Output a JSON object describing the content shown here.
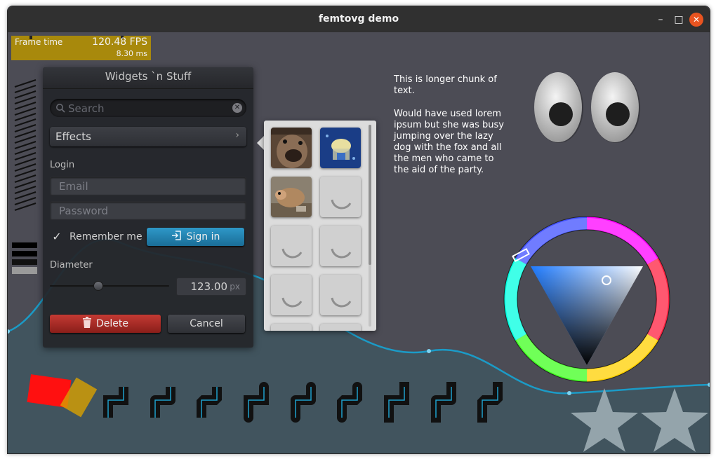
{
  "window": {
    "title": "femtovg demo",
    "minimize_glyph": "–",
    "maximize_glyph": "□",
    "close_glyph": "✕"
  },
  "frame_time": {
    "label": "Frame time",
    "fps": "120.48 FPS",
    "ms": "8.30 ms"
  },
  "panel": {
    "title": "Widgets `n Stuff",
    "search_placeholder": "Search",
    "dropdown_label": "Effects",
    "login_label": "Login",
    "email_placeholder": "Email",
    "password_placeholder": "Password",
    "remember_label": "Remember me",
    "remember_checked": true,
    "signin_label": "Sign in",
    "diameter_label": "Diameter",
    "slider_fraction": 0.4,
    "diameter_value": "123.00",
    "diameter_unit": "px",
    "delete_label": "Delete",
    "cancel_label": "Cancel"
  },
  "thumbnails": {
    "items": [
      {
        "kind": "image",
        "name": "dog"
      },
      {
        "kind": "image",
        "name": "jellyfish"
      },
      {
        "kind": "image",
        "name": "animal"
      },
      {
        "kind": "loading"
      },
      {
        "kind": "loading"
      },
      {
        "kind": "loading"
      },
      {
        "kind": "loading"
      },
      {
        "kind": "loading"
      },
      {
        "kind": "loading"
      },
      {
        "kind": "loading"
      }
    ]
  },
  "text_block": {
    "line1": "This is longer chunk of text.",
    "line2": "Would have used lorem ipsum but she was busy jumping over the lazy dog with the fox and all the men who came to the aid of the party."
  },
  "colors": {
    "signin": "#2386b4",
    "delete": "#a82c27",
    "frame_bar": "#b89400",
    "graph_line": "#1b9bc7",
    "background": "#4c4c55",
    "lower_background": "#41545e"
  }
}
